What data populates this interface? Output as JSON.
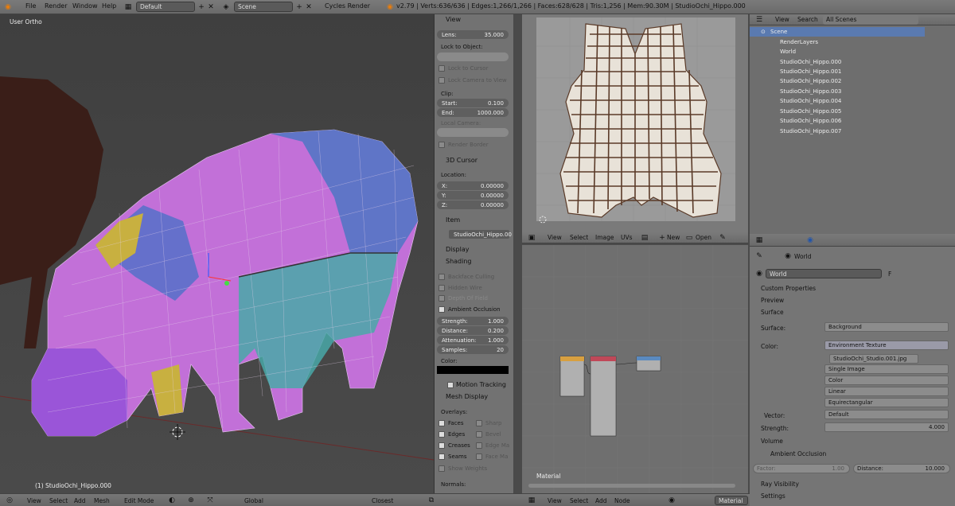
{
  "topbar": {
    "menus": [
      "File",
      "Render",
      "Window",
      "Help"
    ],
    "layout": "Default",
    "scene": "Scene",
    "engine": "Cycles Render",
    "status": "v2.79 | Verts:636/636 | Edges:1,266/1,266 | Faces:628/628 | Tris:1,256 | Mem:90.30M | StudioOchi_Hippo.000"
  },
  "viewport": {
    "view_label": "User Ortho",
    "object_label": "(1) StudioOchi_Hippo.000",
    "bottom": [
      "View",
      "Select",
      "Add",
      "Mesh",
      "Edit Mode",
      "Global",
      "Closest"
    ]
  },
  "npanel": {
    "view_header": "View",
    "lens_label": "Lens:",
    "lens_value": "35.000",
    "lock_object": "Lock to Object:",
    "lock_cursor": "Lock to Cursor",
    "lock_camera": "Lock Camera to View",
    "clip": "Clip:",
    "clip_start_label": "Start:",
    "clip_start": "0.100",
    "clip_end_label": "End:",
    "clip_end": "1000.000",
    "local_camera": "Local Camera:",
    "render_border": "Render Border",
    "cursor_header": "3D Cursor",
    "location": "Location:",
    "x_label": "X:",
    "x": "0.00000",
    "y_label": "Y:",
    "y": "0.00000",
    "z_label": "Z:",
    "z": "0.00000",
    "item_header": "Item",
    "item_name": "StudioOchi_Hippo.00",
    "display_header": "Display",
    "shading_header": "Shading",
    "backface": "Backface Culling",
    "hidden_wire": "Hidden Wire",
    "depth_fx": "Depth Of Field",
    "ao": "Ambient Occlusion",
    "strength_label": "Strength:",
    "strength": "1.000",
    "distance_label": "Distance:",
    "distance": "0.200",
    "atten_label": "Attenuation:",
    "atten": "1.000",
    "samples_label": "Samples:",
    "samples": "20",
    "color_label": "Color:",
    "motion": "Motion Tracking",
    "mesh_display": "Mesh Display",
    "overlays": "Overlays:",
    "faces": "Faces",
    "sharp": "Sharp",
    "edges": "Edges",
    "bevel": "Bevel",
    "creases": "Creases",
    "edge_ma": "Edge Ma",
    "seams": "Seams",
    "face_ma": "Face Ma",
    "show_weights": "Show Weights",
    "normals": "Normals:"
  },
  "uv": {
    "menus": [
      "View",
      "Select",
      "Image",
      "UVs"
    ],
    "new": "New",
    "open": "Open"
  },
  "node": {
    "label": "Material",
    "menus": [
      "View",
      "Select",
      "Add",
      "Node"
    ],
    "type": "Material"
  },
  "outliner": {
    "menus": [
      "View",
      "Search"
    ],
    "filter": "All Scenes",
    "scene": "Scene",
    "render_layers": "RenderLayers",
    "world": "World",
    "objects": [
      "StudioOchi_Hippo.000",
      "StudioOchi_Hippo.001",
      "StudioOchi_Hippo.002",
      "StudioOchi_Hippo.003",
      "StudioOchi_Hippo.004",
      "StudioOchi_Hippo.005",
      "StudioOchi_Hippo.006",
      "StudioOchi_Hippo.007"
    ]
  },
  "props": {
    "context": "World",
    "world_name": "World",
    "fake": "F",
    "custom": "Custom Properties",
    "preview": "Preview",
    "surface_header": "Surface",
    "surface_label": "Surface:",
    "surface_value": "Background",
    "color_label": "Color:",
    "color_value": "Environment Texture",
    "image": "StudioOchi_Studio.001.jpg",
    "single": "Single Image",
    "color_space": "Color",
    "interp": "Linear",
    "proj": "Equirectangular",
    "vector_label": "Vector:",
    "vector_value": "Default",
    "strength_label": "Strength:",
    "strength_value": "4.000",
    "volume": "Volume",
    "ao": "Ambient Occlusion",
    "factor_label": "Factor:",
    "factor": "1.00",
    "distance_label": "Distance:",
    "distance": "10.000",
    "ray": "Ray Visibility",
    "settings": "Settings"
  }
}
